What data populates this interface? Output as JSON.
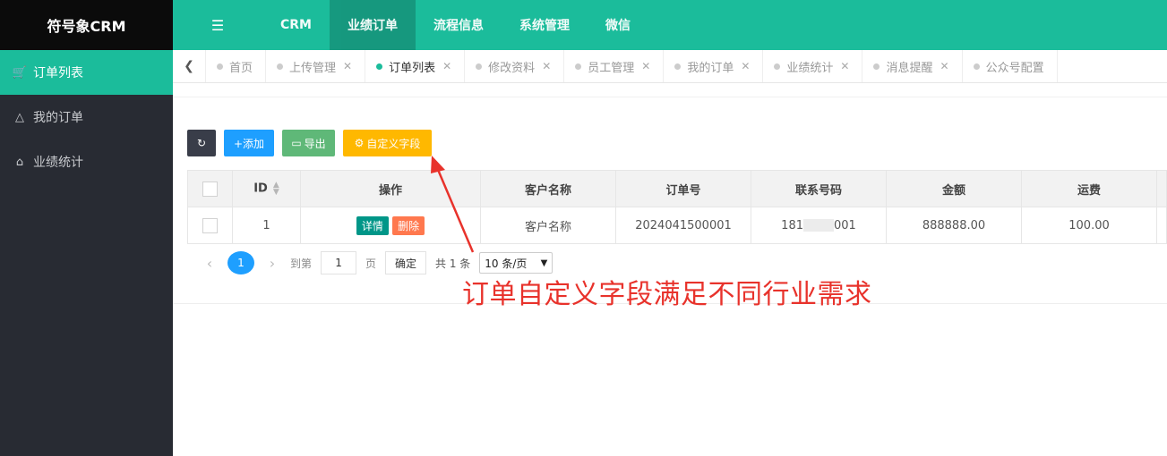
{
  "app": {
    "title": "符号象CRM"
  },
  "topnav": {
    "items": [
      "CRM",
      "业绩订单",
      "流程信息",
      "系统管理",
      "微信"
    ],
    "menu_icon": "menu-icon",
    "active_color": "#16977d",
    "brand_color": "#1bbc9b"
  },
  "sidebar": {
    "items": [
      {
        "label": "订单列表",
        "icon": "cart-icon"
      },
      {
        "label": "我的订单",
        "icon": "basket-icon"
      },
      {
        "label": "业绩统计",
        "icon": "bank-icon"
      }
    ]
  },
  "tabs": [
    "首页",
    "上传管理",
    "订单列表",
    "修改资料",
    "员工管理",
    "我的订单",
    "业绩统计",
    "消息提醒",
    "公众号配置"
  ],
  "toolbar": {
    "add_label": "+添加",
    "export_label": "导出",
    "custom_label": "自定义字段"
  },
  "table": {
    "headers": [
      "ID",
      "操作",
      "客户名称",
      "订单号",
      "联系号码",
      "金额",
      "运费"
    ],
    "rows": [
      {
        "id": "1",
        "detail": "详情",
        "delete": "删除",
        "customer": "客户名称",
        "order_no": "2024041500001",
        "phone_prefix": "181",
        "phone_suffix": "001",
        "amount": "888888.00",
        "freight": "100.00"
      }
    ]
  },
  "pager": {
    "current": "1",
    "goto_label": "到第",
    "page_input": "1",
    "page_label": "页",
    "confirm": "确定",
    "total": "共 1 条",
    "per_page": "10 条/页"
  },
  "annotation": {
    "text": "订单自定义字段满足不同行业需求",
    "color": "#e8322b"
  }
}
